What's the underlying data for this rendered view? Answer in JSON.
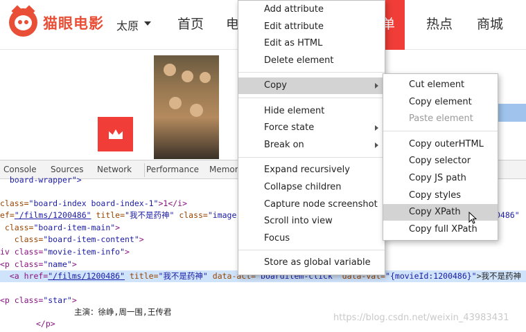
{
  "site": {
    "logo_text": "猫眼电影",
    "city": "太原",
    "nav": {
      "home": "首页",
      "partial": "电",
      "active": "榜单",
      "hot": "热点",
      "mall": "商城"
    },
    "colors": {
      "brand": "#e94f36",
      "active_nav": "#f03d37"
    }
  },
  "devtools": {
    "tabs": [
      "Console",
      "Sources",
      "Network",
      "Performance",
      "Memor"
    ],
    "code": {
      "l0": "  board-wrapper\">",
      "l1_a": "class=",
      "l1_b": "\"board-index board-index-1\"",
      "l1_c": ">1</i>",
      "l2_a": "ef=",
      "l2_b": "\"/films/1200486\"",
      "l2_c": " title=",
      "l2_d": "\"我不是药神\"",
      "l2_e": " class=",
      "l2_f": "\"image-",
      "l2_tail": "0486\"",
      "l3_a": " class=",
      "l3_b": "\"board-item-main\"",
      "l3_c": ">",
      "l4_a": "   class=",
      "l4_b": "\"board-item-content\"",
      "l4_c": ">",
      "l5_a": "iv class=",
      "l5_b": "\"movie-item-info\"",
      "l5_c": ">",
      "l6_a": "<p class=",
      "l6_b": "\"name\"",
      "l6_c": ">",
      "l7_a": "  <a href=",
      "l7_b": "\"/films/1200486\"",
      "l7_c": " title=",
      "l7_d": "\"我不是药神\"",
      "l7_e": " data-act=",
      "l7_f": "\"boarditem-click\"",
      "l7_g": " data-val=",
      "l7_h": "\"{movieId:1200486}\"",
      "l7_i": ">我不是药神",
      "l8_a": "<p class=",
      "l8_b": "\"star\"",
      "l8_c": ">",
      "l9": "主演：徐峥,周一围,王传君",
      "l10": "</p>"
    }
  },
  "context_menu": {
    "items": {
      "add_attribute": "Add attribute",
      "edit_attribute": "Edit attribute",
      "edit_html": "Edit as HTML",
      "delete_element": "Delete element",
      "copy": "Copy",
      "hide_element": "Hide element",
      "force_state": "Force state",
      "break_on": "Break on",
      "expand_recursively": "Expand recursively",
      "collapse_children": "Collapse children",
      "capture_node_screenshot": "Capture node screenshot",
      "scroll_into_view": "Scroll into view",
      "focus": "Focus",
      "store_global": "Store as global variable"
    }
  },
  "copy_submenu": {
    "items": {
      "cut_element": "Cut element",
      "copy_element": "Copy element",
      "paste_element": "Paste element",
      "copy_outer_html": "Copy outerHTML",
      "copy_selector": "Copy selector",
      "copy_js_path": "Copy JS path",
      "copy_styles": "Copy styles",
      "copy_xpath": "Copy XPath",
      "copy_full_xpath": "Copy full XPath"
    }
  },
  "watermark": "https://blog.csdn.net/weixin_43983431"
}
